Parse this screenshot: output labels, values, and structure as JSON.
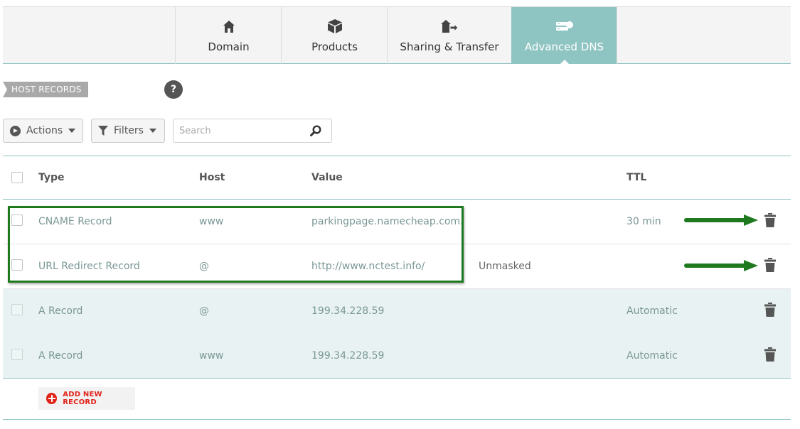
{
  "colors": {
    "accent": "#8ec4c1",
    "row_tint": "#e8f2f2",
    "highlight": "#1f7a1f",
    "add_red": "#e2231a"
  },
  "tabs": [
    {
      "label": "Domain",
      "icon": "home-icon"
    },
    {
      "label": "Products",
      "icon": "box-icon"
    },
    {
      "label": "Sharing & Transfer",
      "icon": "house-transfer-icon"
    },
    {
      "label": "Advanced DNS",
      "icon": "dns-server-icon",
      "active": true
    }
  ],
  "section": {
    "label": "HOST RECORDS",
    "help": "?"
  },
  "toolbar": {
    "actions_label": "Actions",
    "filters_label": "Filters",
    "search_placeholder": "Search"
  },
  "table": {
    "columns": {
      "type": "Type",
      "host": "Host",
      "value": "Value",
      "ttl": "TTL"
    },
    "rows": [
      {
        "type": "CNAME Record",
        "host": "www",
        "value": "parkingpage.namecheap.com.",
        "extra": "",
        "ttl": "30 min"
      },
      {
        "type": "URL Redirect Record",
        "host": "@",
        "value": "http://www.nctest.info/",
        "extra": "Unmasked",
        "ttl": ""
      },
      {
        "type": "A Record",
        "host": "@",
        "value": "199.34.228.59",
        "extra": "",
        "ttl": "Automatic"
      },
      {
        "type": "A Record",
        "host": "www",
        "value": "199.34.228.59",
        "extra": "",
        "ttl": "Automatic"
      }
    ]
  },
  "add_record_label": "ADD NEW RECORD"
}
